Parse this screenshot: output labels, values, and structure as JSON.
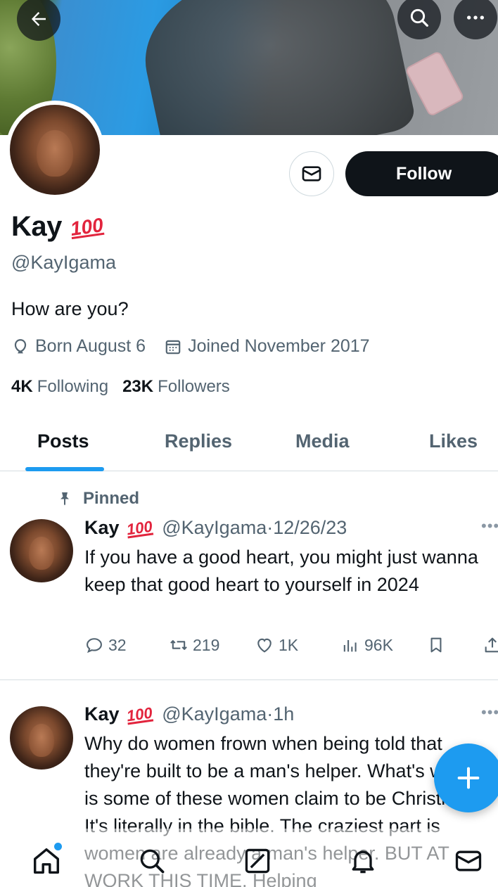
{
  "profile": {
    "display_name": "Kay",
    "badge": "100",
    "handle": "@KayIgama",
    "bio": "How are you?",
    "born": "Born August 6",
    "joined": "Joined November 2017",
    "following_count": "4K",
    "following_label": "Following",
    "followers_count": "23K",
    "followers_label": "Followers",
    "follow_label": "Follow"
  },
  "tabs": [
    {
      "label": "Posts",
      "active": true
    },
    {
      "label": "Replies",
      "active": false
    },
    {
      "label": "Media",
      "active": false
    },
    {
      "label": "Likes",
      "active": false
    }
  ],
  "posts": [
    {
      "pinned_label": "Pinned",
      "name": "Kay",
      "badge": "100",
      "handle_time": "@KayIgama·12/26/23",
      "text": "If you have a good heart, you might just wanna keep that good heart to yourself in 2024",
      "replies": "32",
      "reposts": "219",
      "likes": "1K",
      "views": "96K"
    },
    {
      "name": "Kay",
      "badge": "100",
      "handle_time": "@KayIgama·1h",
      "text": "Why do women frown when being told that they're built to be a man's helper. What's worse is some of these women claim to be Christians. It's literally in the bible. The craziest part is women are already a man's helper. BUT AT WORK THIS TIME. Helping"
    }
  ],
  "icons": {
    "back": "arrow-left-icon",
    "search": "search-icon",
    "more": "more-horizontal-icon",
    "message": "envelope-icon",
    "compose": "plus-icon"
  },
  "colors": {
    "accent": "#1d9bf0",
    "text": "#0f1419",
    "muted": "#536471",
    "badge": "#e2243d"
  }
}
